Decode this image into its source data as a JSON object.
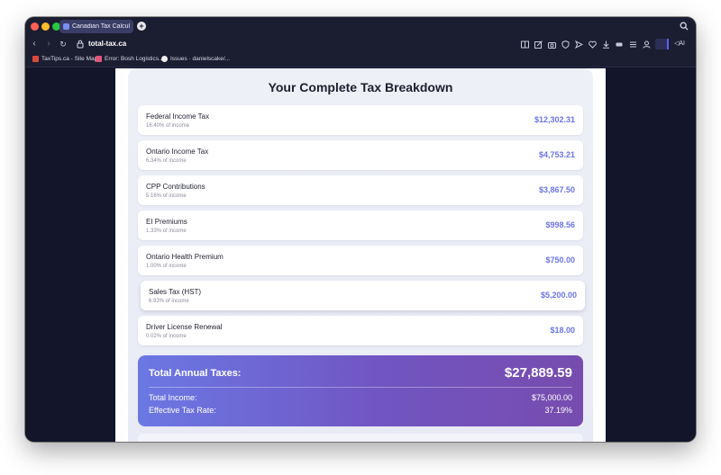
{
  "browser": {
    "tab_title": "Canadian Tax Calculator",
    "url": "total-tax.ca",
    "ai_label": "AI",
    "bookmarks": [
      {
        "label": "TaxTips.ca - Site Map",
        "color": "#d94a3a"
      },
      {
        "label": "Error: Bosh Logistics...",
        "color": "#e2557a"
      },
      {
        "label": "Issues · danielscake/...",
        "color": "#f0f0f0"
      }
    ]
  },
  "breakdown": {
    "title": "Your Complete Tax Breakdown",
    "items": [
      {
        "label": "Federal Income Tax",
        "pct": "16.40% of income",
        "amount": "$12,302.31"
      },
      {
        "label": "Ontario Income Tax",
        "pct": "6.34% of income",
        "amount": "$4,753.21"
      },
      {
        "label": "CPP Contributions",
        "pct": "5.16% of income",
        "amount": "$3,867.50"
      },
      {
        "label": "EI Premiums",
        "pct": "1.33% of income",
        "amount": "$998.56"
      },
      {
        "label": "Ontario Health Premium",
        "pct": "1.00% of income",
        "amount": "$750.00"
      },
      {
        "label": "Sales Tax (HST)",
        "pct": "6.93% of income",
        "amount": "$5,200.00"
      },
      {
        "label": "Driver License Renewal",
        "pct": "0.02% of income",
        "amount": "$18.00"
      }
    ]
  },
  "summary": {
    "total_label": "Total Annual Taxes:",
    "total_amount": "$27,889.59",
    "income_label": "Total Income:",
    "income_value": "$75,000.00",
    "rate_label": "Effective Tax Rate:",
    "rate_value": "37.19%"
  },
  "colors": {
    "accent": "#6a74e6",
    "gradient_start": "#6b78e4",
    "gradient_end": "#774cae"
  }
}
